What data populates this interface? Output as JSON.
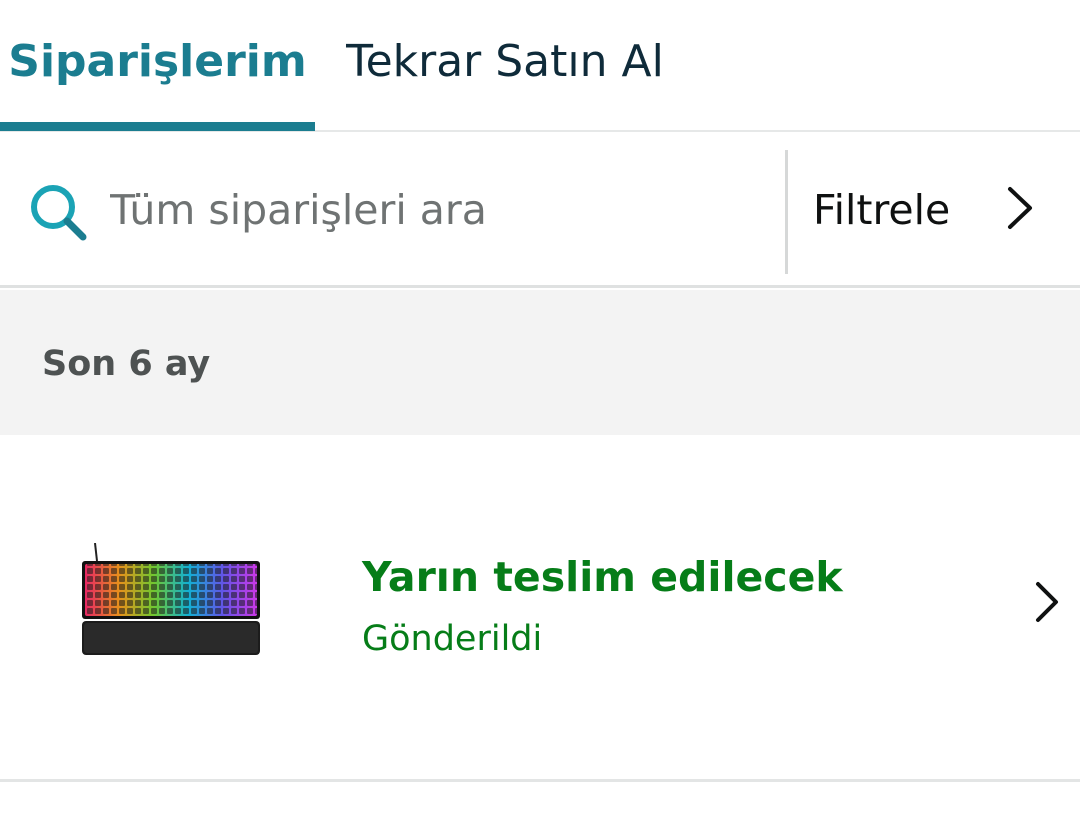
{
  "tabs": [
    {
      "label": "Siparişlerim",
      "active": true
    },
    {
      "label": "Tekrar Satın Al",
      "active": false
    }
  ],
  "search": {
    "placeholder": "Tüm siparişleri ara",
    "value": "",
    "icon": "search-icon"
  },
  "filter": {
    "label": "Filtrele",
    "icon": "chevron-right-icon"
  },
  "section": {
    "title": "Son 6 ay"
  },
  "orders": [
    {
      "status": "Yarın teslim edilecek",
      "substatus": "Gönderildi",
      "image": "rgb-keyboard-product-image",
      "icon": "chevron-right-icon"
    }
  ],
  "colors": {
    "accent": "#1b7d90",
    "status_green": "#067d18",
    "section_bg": "#f3f3f3",
    "text_dark": "#0f1111"
  }
}
